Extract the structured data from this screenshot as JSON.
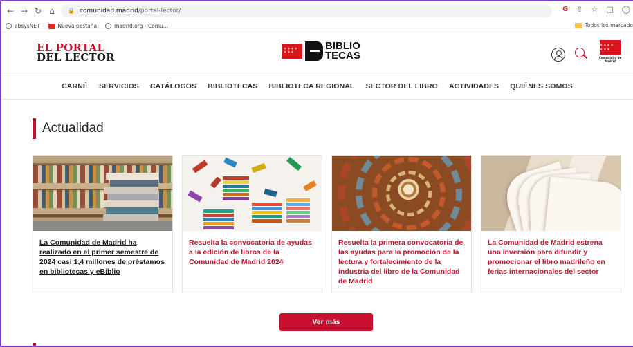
{
  "browser": {
    "url_host": "comunidad.madrid",
    "url_path": "/portal-lector/",
    "bookmarks": [
      "absysNET",
      "Nueva pestaña",
      "madrid.org - Comu..."
    ],
    "bookmarks_right": "Todos los marcado",
    "icons": [
      "back-icon",
      "forward-icon",
      "reload-icon",
      "home-icon",
      "lock-icon",
      "google-icon",
      "share-icon",
      "star-icon",
      "sidebar-icon",
      "profile-icon"
    ]
  },
  "header": {
    "logo_line1": "EL PORTAL",
    "logo_line2": "DEL LECTOR",
    "biblio_line1": "BIBLIO",
    "biblio_line2": "TECAS",
    "cm_text": "Comunidad de Madrid",
    "flag_stars": "✶✶✶✶ ✶✶✶"
  },
  "nav": {
    "items": [
      "CARNÉ",
      "SERVICIOS",
      "CATÁLOGOS",
      "BIBLIOTECAS",
      "BIBLIOTECA REGIONAL",
      "SECTOR DEL LIBRO",
      "ACTIVIDADES",
      "QUIÉNES SOMOS"
    ]
  },
  "main": {
    "section_title": "Actualidad",
    "cards": [
      "La Comunidad de Madrid ha realizado en el primer semestre de 2024 casi 1,4 millones de préstamos en bibliotecas y eBiblio",
      "Resuelta la convocatoria de ayudas a la edición de libros de la Comunidad de Madrid 2024",
      "Resuelta la primera convocatoria de las ayudas para la promoción de la lectura y fortalecimiento de la industria del libro de la Comunidad de Madrid",
      "La Comunidad de Madrid estrena una inversión para difundir y promocionar el libro madrileño en ferias internacionales del sector"
    ],
    "more_label": "Ver más"
  },
  "colors": {
    "brand_red": "#c8102e",
    "frame": "#7a3fd1"
  }
}
